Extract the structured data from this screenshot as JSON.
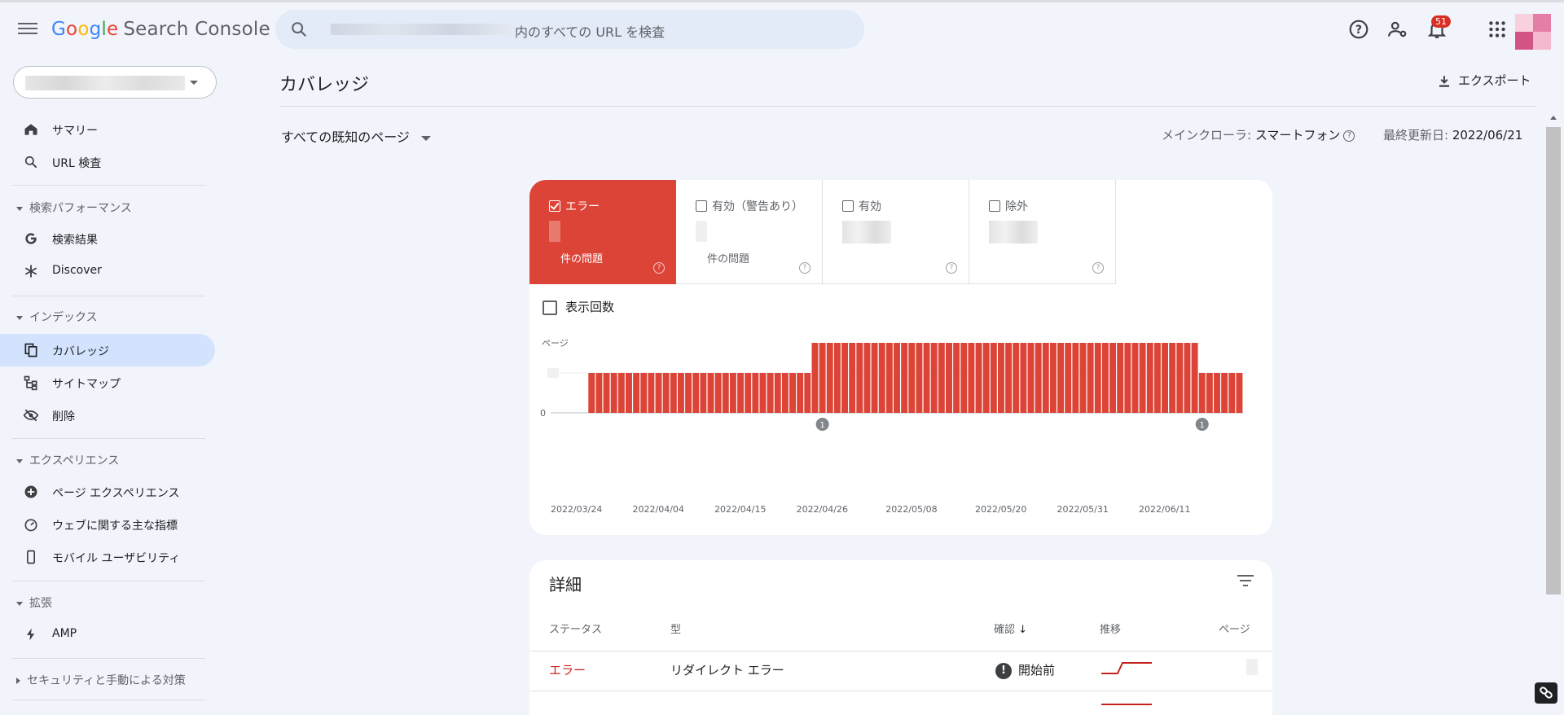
{
  "app": {
    "logo_google": "Google",
    "logo_product": "Search Console"
  },
  "header": {
    "search_placeholder": "内のすべての URL を検査",
    "notification_count": "51"
  },
  "sidebar": {
    "items_top": [
      {
        "label": "サマリー",
        "icon": "home-icon"
      },
      {
        "label": "URL 検査",
        "icon": "search-icon"
      }
    ],
    "sections": [
      {
        "label": "検索パフォーマンス",
        "items": [
          {
            "label": "検索結果",
            "icon": "google-g-icon"
          },
          {
            "label": "Discover",
            "icon": "asterisk-icon"
          }
        ]
      },
      {
        "label": "インデックス",
        "items": [
          {
            "label": "カバレッジ",
            "icon": "pages-icon",
            "active": true
          },
          {
            "label": "サイトマップ",
            "icon": "sitemap-icon"
          },
          {
            "label": "削除",
            "icon": "eye-off-icon"
          }
        ]
      },
      {
        "label": "エクスペリエンス",
        "items": [
          {
            "label": "ページ エクスペリエンス",
            "icon": "plus-circle-icon"
          },
          {
            "label": "ウェブに関する主な指標",
            "icon": "gauge-icon"
          },
          {
            "label": "モバイル ユーザビリティ",
            "icon": "phone-icon"
          }
        ]
      },
      {
        "label": "拡張",
        "items": [
          {
            "label": "AMP",
            "icon": "bolt-icon"
          }
        ]
      },
      {
        "label": "セキュリティと手動による対策",
        "items": []
      }
    ]
  },
  "main": {
    "title": "カバレッジ",
    "export_label": "エクスポート",
    "filter_label": "すべての既知のページ",
    "crawler_label": "メインクローラ:",
    "crawler_value": "スマートフォン",
    "updated_label": "最終更新日:",
    "updated_value": "2022/06/21"
  },
  "coverage": {
    "tiles": [
      {
        "label": "エラー",
        "issues": "件の問題",
        "checked": true,
        "color": "#db4437"
      },
      {
        "label": "有効（警告あり）",
        "issues": "件の問題",
        "checked": false
      },
      {
        "label": "有効",
        "issues": "",
        "checked": false
      },
      {
        "label": "除外",
        "issues": "",
        "checked": false
      }
    ],
    "impressions_label": "表示回数",
    "annotation_marker": "1"
  },
  "chart_data": {
    "type": "bar",
    "ylabel": "ページ",
    "y_ticks": [
      "0"
    ],
    "x_ticks": [
      "2022/03/24",
      "2022/04/04",
      "2022/04/15",
      "2022/04/26",
      "2022/05/08",
      "2022/05/20",
      "2022/05/31",
      "2022/06/11"
    ],
    "series": [
      {
        "color": "#db4437",
        "segments": [
          {
            "from": "2022/03/26",
            "to": "2022/04/24",
            "level": 1
          },
          {
            "from": "2022/04/25",
            "to": "2022/06/15",
            "level": 2
          },
          {
            "from": "2022/06/16",
            "to": "2022/06/21",
            "level": 1
          }
        ]
      }
    ],
    "annotations": [
      {
        "date": "2022/04/26",
        "label": "1"
      },
      {
        "date": "2022/06/16",
        "label": "1"
      }
    ],
    "grid": true,
    "legend": "none"
  },
  "details": {
    "title": "詳細",
    "columns": [
      "ステータス",
      "型",
      "確認",
      "推移",
      "ページ"
    ],
    "rows": [
      {
        "status": "エラー",
        "type": "リダイレクト エラー",
        "validation": "開始前"
      }
    ]
  }
}
